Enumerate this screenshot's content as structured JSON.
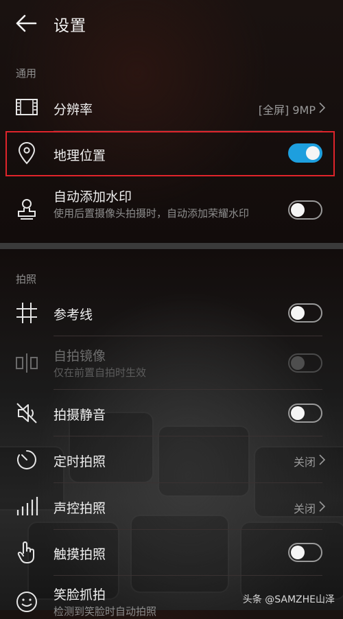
{
  "header": {
    "title": "设置"
  },
  "sections": {
    "general": "通用",
    "photo": "拍照"
  },
  "rows": {
    "resolution": {
      "label": "分辨率",
      "value": "[全屏] 9MP"
    },
    "location": {
      "label": "地理位置",
      "toggle": "on"
    },
    "watermark": {
      "label": "自动添加水印",
      "sub": "使用后置摄像头拍摄时，自动添加荣耀水印",
      "toggle": "off"
    },
    "grid": {
      "label": "参考线",
      "toggle": "off"
    },
    "mirror": {
      "label": "自拍镜像",
      "sub": "仅在前置自拍时生效",
      "toggle": "disabled"
    },
    "mute": {
      "label": "拍摄静音",
      "toggle": "off"
    },
    "timer": {
      "label": "定时拍照",
      "value": "关闭"
    },
    "voice": {
      "label": "声控拍照",
      "value": "关闭"
    },
    "touch": {
      "label": "触摸拍照",
      "toggle": "off"
    },
    "smile": {
      "label": "笑脸抓拍",
      "sub": "检测到笑脸时自动拍照"
    }
  },
  "footer": {
    "watermark": "头条 @SAMZHE山泽"
  },
  "colors": {
    "accent": "#1e9fde",
    "highlight": "#e0242b"
  }
}
